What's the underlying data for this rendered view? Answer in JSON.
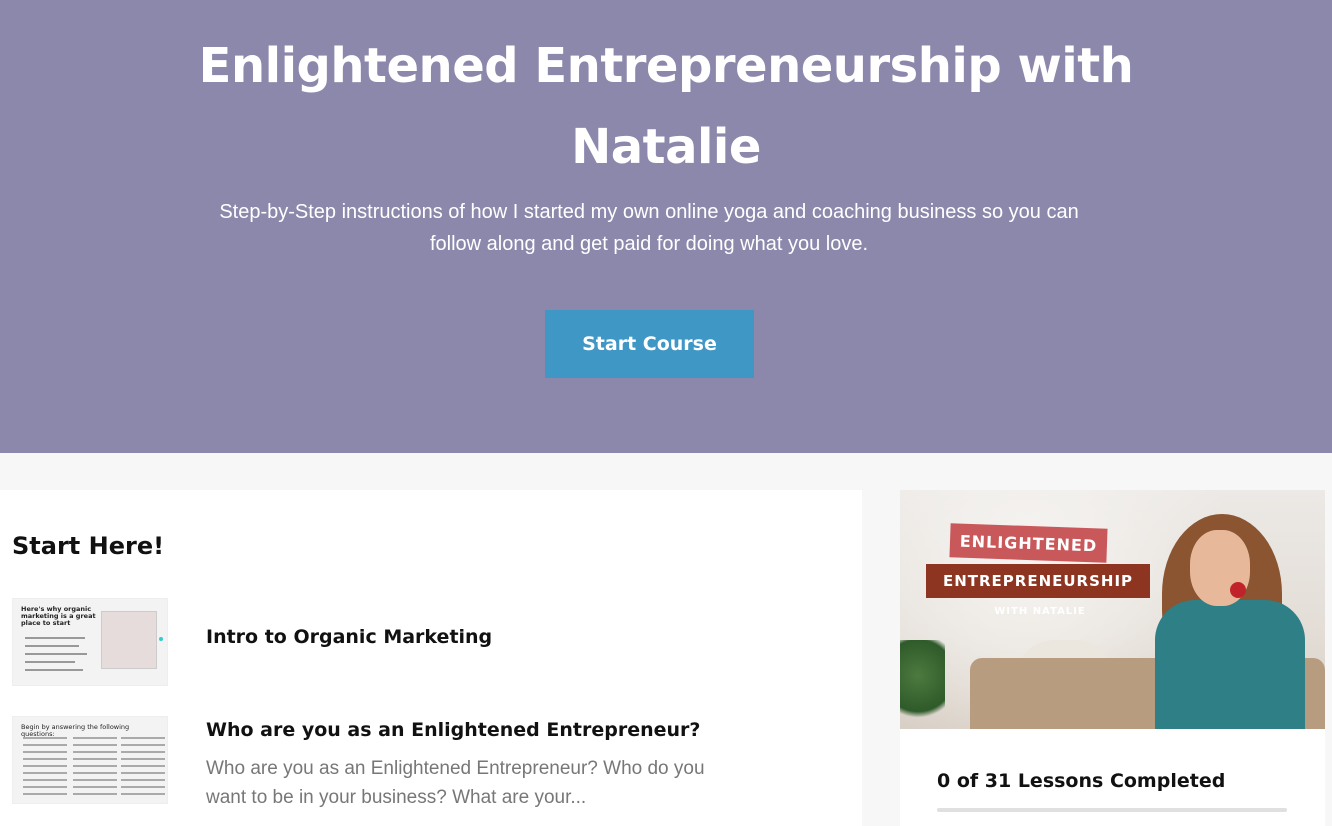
{
  "hero": {
    "title": "Enlightened Entrepreneurship with Natalie",
    "subtitle": "Step-by-Step instructions of how I started my own online yoga and coaching business so you can follow along and get paid for doing what you love.",
    "start_button": "Start Course",
    "background_color": "#8b88ac",
    "button_color": "#3e97c5"
  },
  "section": {
    "title": "Start Here!"
  },
  "lessons": [
    {
      "title": "Intro to Organic Marketing",
      "description": "",
      "thumbnail_text": "Here's why organic marketing is a great place to start"
    },
    {
      "title": "Who are you as an Enlightened Entrepreneur?",
      "description": "Who are you as an Enlightened Entrepreneur? Who do you want to be in your business? What are your...",
      "thumbnail_text": "Begin by answering the following questions:"
    }
  ],
  "course_card": {
    "tag_line_1": "ENLIGHTENED",
    "tag_line_2": "ENTREPRENEURSHIP",
    "tag_line_3": "WITH NATALIE",
    "progress_text": "0 of 31 Lessons Completed",
    "progress_fraction": 0
  }
}
